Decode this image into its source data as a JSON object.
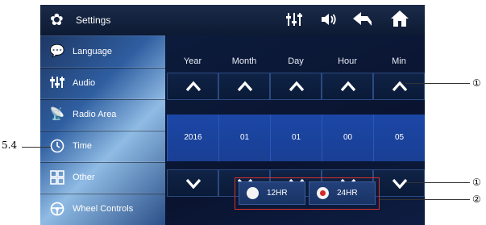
{
  "header": {
    "title": "Settings",
    "icons": [
      "gear-icon",
      "equalizer-icon",
      "volume-icon",
      "back-icon",
      "home-icon"
    ]
  },
  "sidebar": {
    "items": [
      {
        "label": "Language",
        "icon": "language-icon"
      },
      {
        "label": "Audio",
        "icon": "audio-icon"
      },
      {
        "label": "Radio Area",
        "icon": "radio-area-icon"
      },
      {
        "label": "Time",
        "icon": "time-icon"
      },
      {
        "label": "Other",
        "icon": "other-icon"
      },
      {
        "label": "Wheel Controls",
        "icon": "wheel-controls-icon"
      }
    ]
  },
  "time": {
    "columns": [
      {
        "header": "Year",
        "value": "2016"
      },
      {
        "header": "Month",
        "value": "01"
      },
      {
        "header": "Day",
        "value": "01"
      },
      {
        "header": "Hour",
        "value": "00"
      },
      {
        "header": "Min",
        "value": "05"
      }
    ],
    "format_options": [
      {
        "label": "12HR",
        "selected": false
      },
      {
        "label": "24HR",
        "selected": true
      }
    ]
  },
  "annotations": {
    "left": "5.4",
    "up_callout": "①",
    "down_callout": "①",
    "format_callout": "②"
  },
  "colors": {
    "highlight_red": "#d8302a",
    "value_blue": "#1b47a6"
  }
}
